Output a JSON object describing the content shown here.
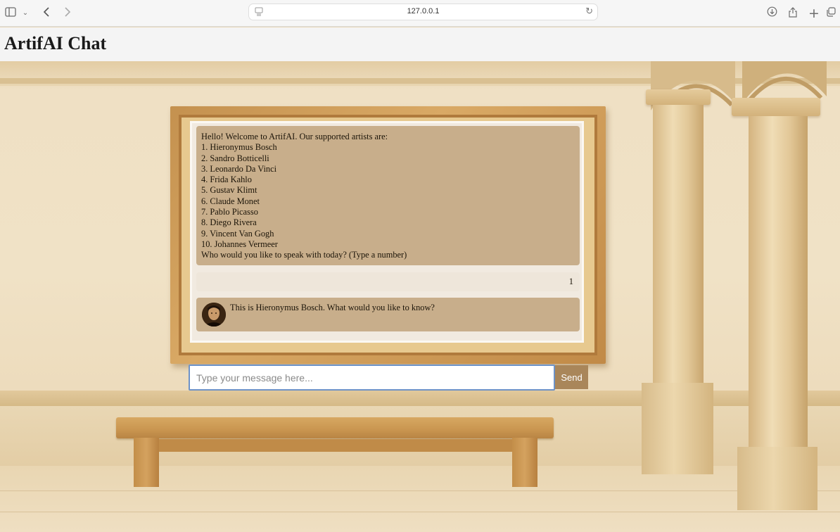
{
  "browser": {
    "url": "127.0.0.1",
    "icons": {
      "sidebar": "sidebar-toggle-icon",
      "back": "back-arrow-icon",
      "forward": "forward-arrow-icon",
      "reload": "reload-icon",
      "download": "download-icon",
      "share": "share-icon",
      "new_tab": "plus-icon",
      "tabs": "tab-overview-icon"
    }
  },
  "header": {
    "title": "ArtifAI Chat"
  },
  "chat": {
    "messages": [
      {
        "sender": "bot",
        "lines": [
          "Hello! Welcome to ArtifAI. Our supported artists are:",
          "1. Hieronymus Bosch",
          "2. Sandro Botticelli",
          "3. Leonardo Da Vinci",
          "4. Frida Kahlo",
          "5. Gustav Klimt",
          "6. Claude Monet",
          "7. Pablo Picasso",
          "8. Diego Rivera",
          "9. Vincent Van Gogh",
          "10. Johannes Vermeer",
          "Who would you like to speak with today? (Type a number)"
        ]
      },
      {
        "sender": "user",
        "text": "1"
      },
      {
        "sender": "bot",
        "text": "This is Hieronymus Bosch. What would you like to know?",
        "avatar": "artist-portrait-avatar"
      }
    ]
  },
  "input": {
    "placeholder": "Type your message here...",
    "value": ""
  },
  "send": {
    "label": "Send"
  },
  "colors": {
    "bot_bubble": "#c8ae8b",
    "user_bubble": "#eee6da",
    "send_button": "#a9865a",
    "input_border": "#6e93c8",
    "frame": "#d2a15d"
  }
}
